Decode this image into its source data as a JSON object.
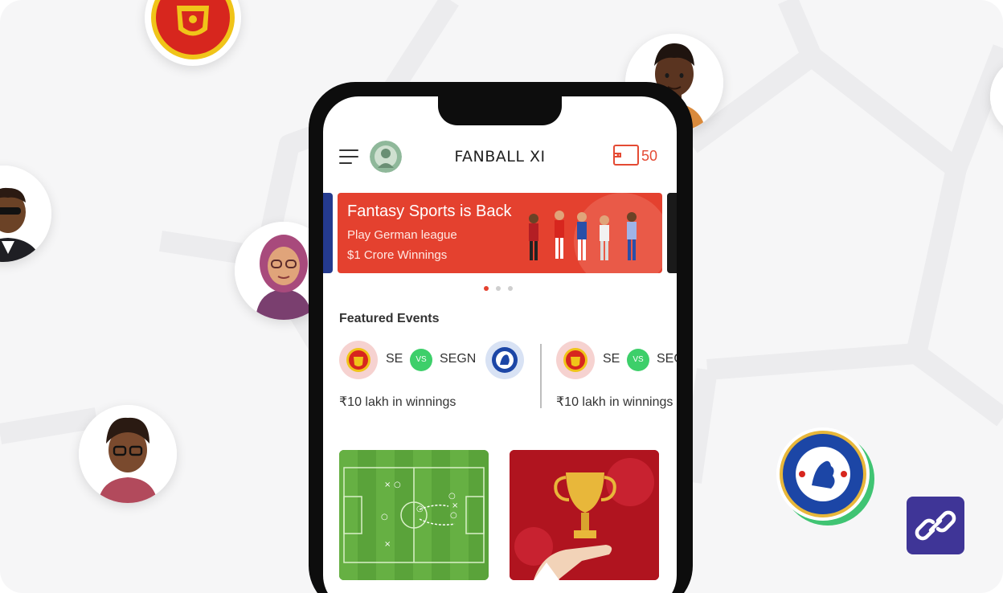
{
  "app": {
    "title": "FANBALL XI",
    "coin_count": "50"
  },
  "banner": {
    "title": "Fantasy Sports is Back",
    "line1": "Play German league",
    "line2": "$1 Crore Winnings",
    "active_index": 0,
    "total": 3
  },
  "featured": {
    "title": "Featured Events",
    "events": [
      {
        "team1": "SE",
        "vs": "VS",
        "team2": "SEGN",
        "winnings": "₹10 lakh in winnings"
      },
      {
        "team1": "SE",
        "vs": "VS",
        "team2": "SEGN",
        "winnings": "₹10 lakh in winnings"
      }
    ]
  },
  "colors": {
    "accent": "#e4412f",
    "vs": "#3dcf6a",
    "link_button": "#3f3597"
  },
  "icons": {
    "menu": "hamburger-menu-icon",
    "coins": "wallet-icon",
    "link": "link-icon"
  }
}
